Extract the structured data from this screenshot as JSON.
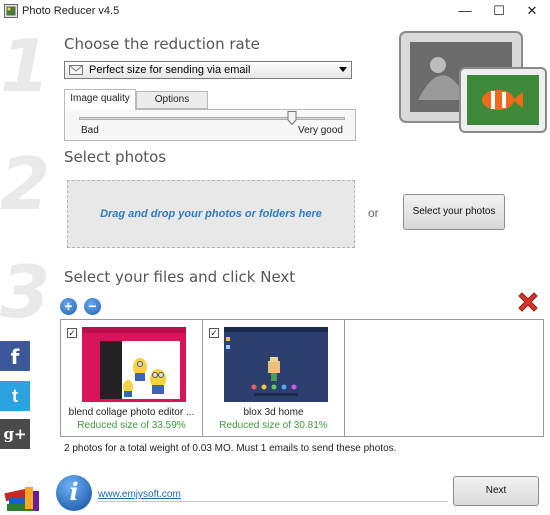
{
  "window": {
    "title": "Photo Reducer v4.5",
    "min_glyph": "—",
    "max_glyph": "☐",
    "close_glyph": "✕"
  },
  "steps": {
    "one": "1",
    "two": "2",
    "three": "3"
  },
  "step1": {
    "heading": "Choose the reduction rate",
    "preset_value": "Perfect size for sending via email",
    "tabs": [
      "Image quality",
      "Options"
    ],
    "active_tab": "Image quality",
    "slider": {
      "min_label": "Bad",
      "max_label": "Very good",
      "value_fraction": 0.8
    }
  },
  "step2": {
    "heading": "Select photos",
    "drop_text": "Drag and drop your photos or folders here",
    "or_text": "or",
    "select_button": "Select your photos"
  },
  "step3": {
    "heading": "Select your files and click Next",
    "add_glyph": "+",
    "remove_glyph": "−",
    "files": [
      {
        "name": "blend collage photo editor ...",
        "reduction": "Reduced size of 33.59%",
        "checked": true,
        "check_glyph": "✓"
      },
      {
        "name": "blox 3d home",
        "reduction": "Reduced size of 30.81%",
        "checked": true,
        "check_glyph": "✓"
      }
    ],
    "summary": "2 photos for a total weight of 0.03 MO. Must 1 emails to send these photos."
  },
  "social": {
    "facebook": "f",
    "twitter": "t",
    "googleplus": "g+"
  },
  "footer": {
    "info_glyph": "i",
    "link": "www.emjysoft.com",
    "next_button": "Next"
  },
  "colors": {
    "accent_blue": "#2e7cc0",
    "success_green": "#3d9b3d",
    "delete_red": "#d9362b"
  }
}
